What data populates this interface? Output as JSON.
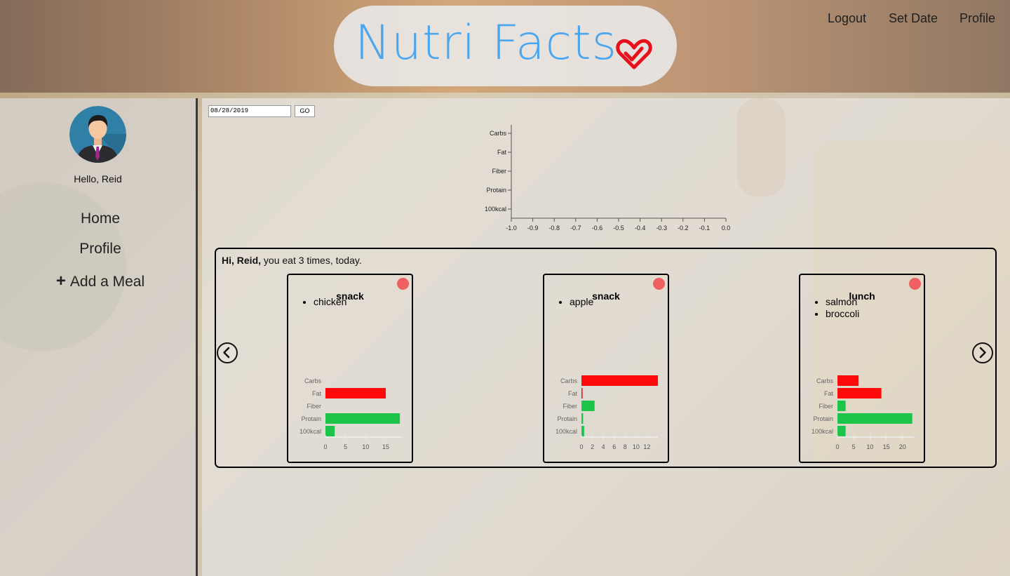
{
  "header": {
    "logo_text": "Nutri Facts",
    "nav": [
      "Logout",
      "Set Date",
      "Profile"
    ]
  },
  "sidebar": {
    "greeting": "Hello, Reid",
    "items": [
      {
        "label": "Home",
        "icon": ""
      },
      {
        "label": "Profile",
        "icon": ""
      },
      {
        "label": "Add a Meal",
        "icon": "plus-icon"
      }
    ]
  },
  "date_picker": {
    "value": "08/28/2019",
    "button_label": "GO"
  },
  "summary_chart": {
    "type": "bar",
    "categories": [
      "Carbs",
      "Fat",
      "Fiber",
      "Protain",
      "100kcal"
    ],
    "x_ticks": [
      "-1.0",
      "-0.9",
      "-0.8",
      "-0.7",
      "-0.6",
      "-0.5",
      "-0.4",
      "-0.3",
      "-0.2",
      "-0.1",
      "0.0"
    ],
    "values": []
  },
  "meals": {
    "intro_bold": "Hi, Reid,",
    "intro_rest": " you eat 3 times, today.",
    "cards": [
      {
        "title": "snack",
        "foods": [
          "chicken"
        ]
      },
      {
        "title": "snack",
        "foods": [
          "apple"
        ]
      },
      {
        "title": "lunch",
        "foods": [
          "salmon",
          "broccoli"
        ]
      }
    ]
  },
  "colors": {
    "logo": "#4ba6f0",
    "heart": "#e8101a",
    "bar_red": "#ff0a0a",
    "bar_green": "#1ec44a",
    "delete_dot": "#f06060"
  },
  "chart_data": [
    {
      "type": "bar",
      "orientation": "horizontal",
      "categories": [
        "Carbs",
        "Fat",
        "Fiber",
        "Protain",
        "100kcal"
      ],
      "x_ticks": [
        -1.0,
        -0.9,
        -0.8,
        -0.7,
        -0.6,
        -0.5,
        -0.4,
        -0.3,
        -0.2,
        -0.1,
        0.0
      ],
      "xlim": [
        -1.0,
        0.0
      ],
      "values": [
        0,
        0,
        0,
        0,
        0
      ]
    },
    {
      "type": "bar",
      "orientation": "horizontal",
      "card": "snack - chicken",
      "categories": [
        "Carbs",
        "Fat",
        "Fiber",
        "Protain",
        "100kcal"
      ],
      "values": [
        0,
        15,
        0,
        18.5,
        2.3
      ],
      "colors": [
        "#ff0a0a",
        "#ff0a0a",
        "#1ec44a",
        "#1ec44a",
        "#1ec44a"
      ],
      "x_ticks": [
        0,
        5,
        10,
        15
      ],
      "xlim": [
        0,
        19
      ]
    },
    {
      "type": "bar",
      "orientation": "horizontal",
      "card": "snack - apple",
      "categories": [
        "Carbs",
        "Fat",
        "Fiber",
        "Protain",
        "100kcal"
      ],
      "values": [
        14,
        0.2,
        2.4,
        0.3,
        0.5
      ],
      "colors": [
        "#ff0a0a",
        "#ff0a0a",
        "#1ec44a",
        "#1ec44a",
        "#1ec44a"
      ],
      "x_ticks": [
        0,
        2,
        4,
        6,
        8,
        10,
        12
      ],
      "xlim": [
        0,
        14
      ]
    },
    {
      "type": "bar",
      "orientation": "horizontal",
      "card": "lunch - salmon, broccoli",
      "categories": [
        "Carbs",
        "Fat",
        "Fiber",
        "Protain",
        "100kcal"
      ],
      "values": [
        6.5,
        13.5,
        2.5,
        23,
        2.5
      ],
      "colors": [
        "#ff0a0a",
        "#ff0a0a",
        "#1ec44a",
        "#1ec44a",
        "#1ec44a"
      ],
      "x_ticks": [
        0,
        5,
        10,
        15,
        20
      ],
      "xlim": [
        0,
        23.5
      ]
    }
  ]
}
